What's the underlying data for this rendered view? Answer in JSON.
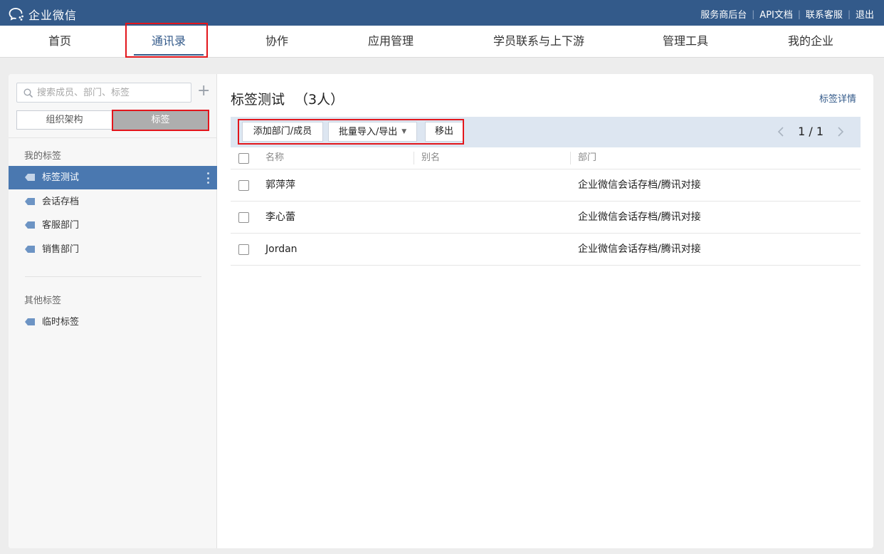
{
  "app": {
    "logo_text": "企业微信"
  },
  "top_links": [
    "服务商后台",
    "API文档",
    "联系客服",
    "退出"
  ],
  "nav": {
    "items": [
      "首页",
      "通讯录",
      "协作",
      "应用管理",
      "学员联系与上下游",
      "管理工具",
      "我的企业"
    ],
    "active": "通讯录"
  },
  "sidebar": {
    "search_placeholder": "搜索成员、部门、标签",
    "add_icon": "plus-icon",
    "segments": [
      "组织架构",
      "标签"
    ],
    "active_segment": "标签",
    "my_tags_title": "我的标签",
    "my_tags": [
      "标签测试",
      "会话存档",
      "客服部门",
      "销售部门"
    ],
    "selected_tag": "标签测试",
    "other_tags_title": "其他标签",
    "other_tags": [
      "临时标签"
    ]
  },
  "main": {
    "title": "标签测试",
    "count": "（3人）",
    "detail_link": "标签详情",
    "toolbar": {
      "add_button": "添加部门/成员",
      "import_button": "批量导入/导出",
      "remove_button": "移出"
    },
    "pager": {
      "text": "1 / 1"
    },
    "columns": [
      "名称",
      "别名",
      "部门"
    ],
    "rows": [
      {
        "name": "郭萍萍",
        "alias": "",
        "dept": "企业微信会话存档/腾讯对接"
      },
      {
        "name": "李心蕾",
        "alias": "",
        "dept": "企业微信会话存档/腾讯对接"
      },
      {
        "name": "Jordan",
        "alias": "",
        "dept": "企业微信会话存档/腾讯对接"
      }
    ]
  },
  "colors": {
    "topbar": "#335a8a",
    "accent": "#335a8a",
    "selected_row": "#4a78b0",
    "toolbar_bg": "#dde6f1",
    "highlight_box": "#e3161c"
  }
}
